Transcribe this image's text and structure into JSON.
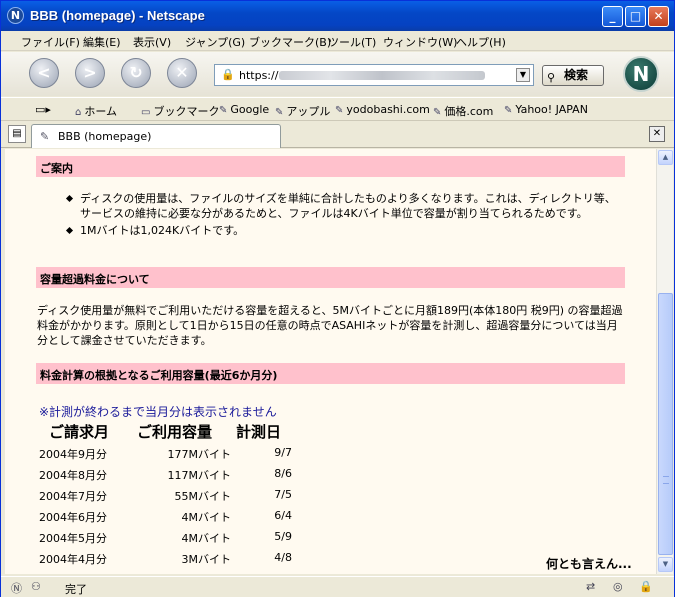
{
  "window": {
    "title": "BBB (homepage) - Netscape"
  },
  "menu": [
    "ファイル(F)",
    "編集(E)",
    "表示(V)",
    "ジャンプ(G)",
    "ブックマーク(B)",
    "ツール(T)",
    "ウィンドウ(W)",
    "ヘルプ(H)"
  ],
  "url": {
    "prefix": "https://"
  },
  "search_label": "検索",
  "bookmarks": [
    "ホーム",
    "ブックマーク",
    "Google",
    "アップル",
    "yodobashi.com",
    "価格.com",
    "Yahoo! JAPAN"
  ],
  "tab": {
    "label": "BBB (homepage)"
  },
  "content": {
    "section1_title": "ご案内",
    "bullets": [
      "ディスクの使用量は、ファイルのサイズを単純に合計したものより多くなります。これは、ディレクトリ等、サービスの維持に必要な分があるためと、ファイルは4Kバイト単位で容量が割り当てられるためです。",
      "1Mバイトは1,024Kバイトです。"
    ],
    "section2_title": "容量超過料金について",
    "section2_text": "ディスク使用量が無料でご利用いただける容量を超えると、5Mバイトごとに月額189円(本体180円 税9円) の容量超過料金がかかります。原則として1日から15日の任意の時点でASAHIネットが容量を計測し、超過容量分については当月分として課金させていただきます。",
    "section3_title": "料金計算の根拠となるご利用容量(最近6か月分)",
    "note": "※計測が終わるまで当月分は表示されません",
    "table_headers": [
      "ご請求月",
      "ご利用容量",
      "計測日"
    ],
    "rows": [
      {
        "month": "2004年9月分",
        "usage": "177Mバイト",
        "date": "9/7"
      },
      {
        "month": "2004年8月分",
        "usage": "117Mバイト",
        "date": "8/6"
      },
      {
        "month": "2004年7月分",
        "usage": "55Mバイト",
        "date": "7/5"
      },
      {
        "month": "2004年6月分",
        "usage": "4Mバイト",
        "date": "6/4"
      },
      {
        "month": "2004年5月分",
        "usage": "4Mバイト",
        "date": "5/9"
      },
      {
        "month": "2004年4月分",
        "usage": "3Mバイト",
        "date": "4/8"
      }
    ],
    "footer_note": "何とも言えん..."
  },
  "status": {
    "text": "完了"
  }
}
